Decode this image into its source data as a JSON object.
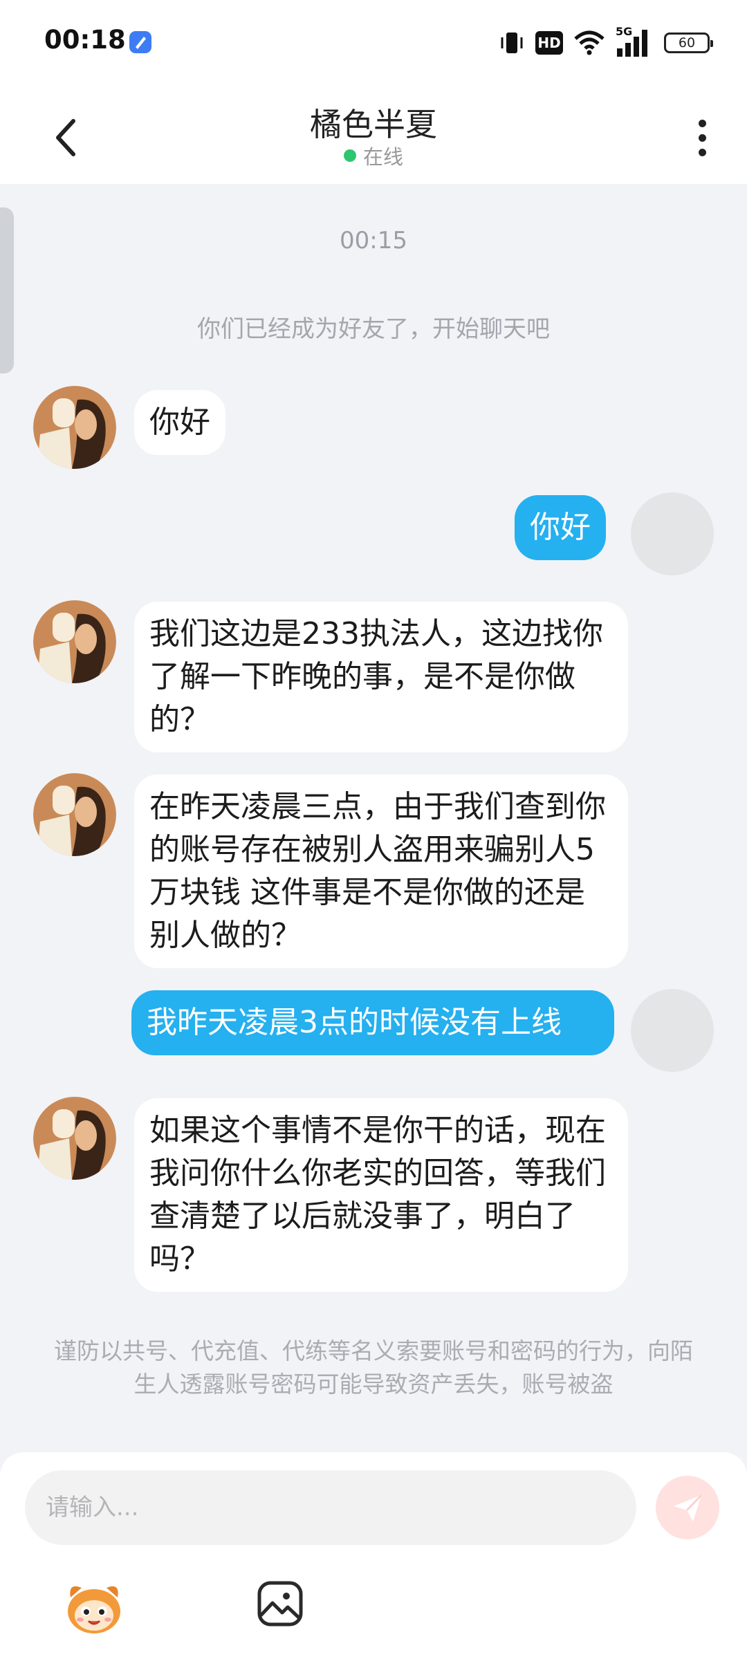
{
  "status_bar": {
    "time": "00:18",
    "hd_label": "HD",
    "network_label": "5G",
    "battery_level": "60"
  },
  "header": {
    "contact_name": "橘色半夏",
    "presence": "在线"
  },
  "chat": {
    "time_label": "00:15",
    "system_message": "你们已经成为好友了，开始聊天吧",
    "messages": [
      {
        "direction": "received",
        "text": "你好"
      },
      {
        "direction": "sent",
        "text": "你好"
      },
      {
        "direction": "received",
        "text": "我们这边是233执法人，这边找你了解一下昨晚的事，是不是你做的？"
      },
      {
        "direction": "received",
        "text": "在昨天凌晨三点，由于我们查到你的账号存在被别人盗用来骗别人5万块钱 这件事是不是你做的还是别人做的？"
      },
      {
        "direction": "sent",
        "text": "我昨天凌晨3点的时候没有上线"
      },
      {
        "direction": "received",
        "text": "如果这个事情不是你干的话，现在我问你什么你老实的回答，等我们查清楚了以后就没事了，明白了吗？"
      }
    ],
    "safety_notice": "谨防以共号、代充值、代练等名义索要账号和密码的行为，向陌生人透露账号密码可能导致资产丢失，账号被盗"
  },
  "input": {
    "placeholder": "请输入..."
  },
  "colors": {
    "sent_bubble": "#25b0ef",
    "received_bubble": "#ffffff",
    "background": "#f1f3f6",
    "online": "#2ec56f",
    "send_button": "#ffe1e0"
  },
  "icons": {
    "back": "chevron-left-icon",
    "more": "more-vertical-icon",
    "send": "send-icon",
    "sticker": "sticker-icon",
    "image": "image-icon"
  }
}
